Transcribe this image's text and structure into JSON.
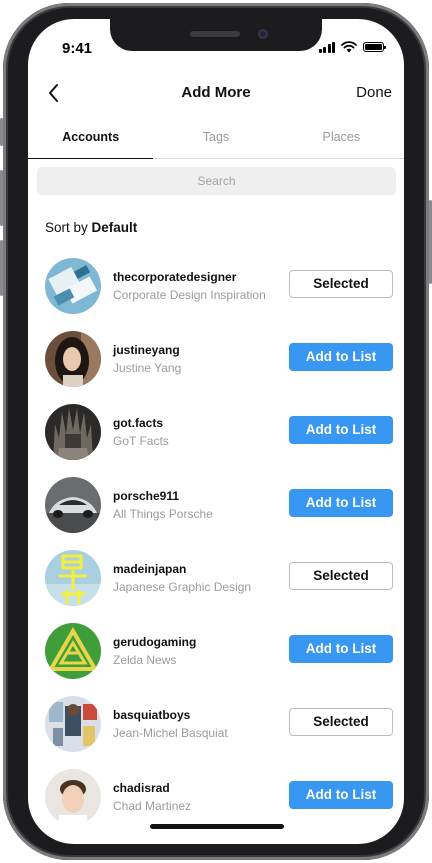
{
  "status_bar": {
    "time": "9:41"
  },
  "nav": {
    "title": "Add More",
    "done_label": "Done"
  },
  "tabs": [
    {
      "label": "Accounts",
      "active": true
    },
    {
      "label": "Tags",
      "active": false
    },
    {
      "label": "Places",
      "active": false
    }
  ],
  "search": {
    "placeholder": "Search"
  },
  "sort": {
    "prefix": "Sort by",
    "value": "Default"
  },
  "accounts": [
    {
      "username": "thecorporatedesigner",
      "full_name": "Corporate Design Inspiration",
      "action": "Selected",
      "state": "selected",
      "avatar": "corporate-design-avatar"
    },
    {
      "username": "justineyang",
      "full_name": "Justine Yang",
      "action": "Add to List",
      "state": "add",
      "avatar": "portrait-avatar"
    },
    {
      "username": "got.facts",
      "full_name": "GoT Facts",
      "action": "Add to List",
      "state": "add",
      "avatar": "iron-throne-avatar"
    },
    {
      "username": "porsche911",
      "full_name": "All Things Porsche",
      "action": "Add to List",
      "state": "add",
      "avatar": "car-avatar"
    },
    {
      "username": "madeinjapan",
      "full_name": "Japanese Graphic Design",
      "action": "Selected",
      "state": "selected",
      "avatar": "japanese-poster-avatar"
    },
    {
      "username": "gerudogaming",
      "full_name": "Zelda News",
      "action": "Add to List",
      "state": "add",
      "avatar": "triforce-avatar"
    },
    {
      "username": "basquiatboys",
      "full_name": "Jean-Michel Basquiat",
      "action": "Selected",
      "state": "selected",
      "avatar": "artwork-avatar"
    },
    {
      "username": "chadisrad",
      "full_name": "Chad Martinez",
      "action": "Add to List",
      "state": "add",
      "avatar": "portrait-avatar"
    }
  ],
  "colors": {
    "accent": "#3897f0",
    "muted_text": "#9b9b9b",
    "divider": "#dbdbdb"
  }
}
